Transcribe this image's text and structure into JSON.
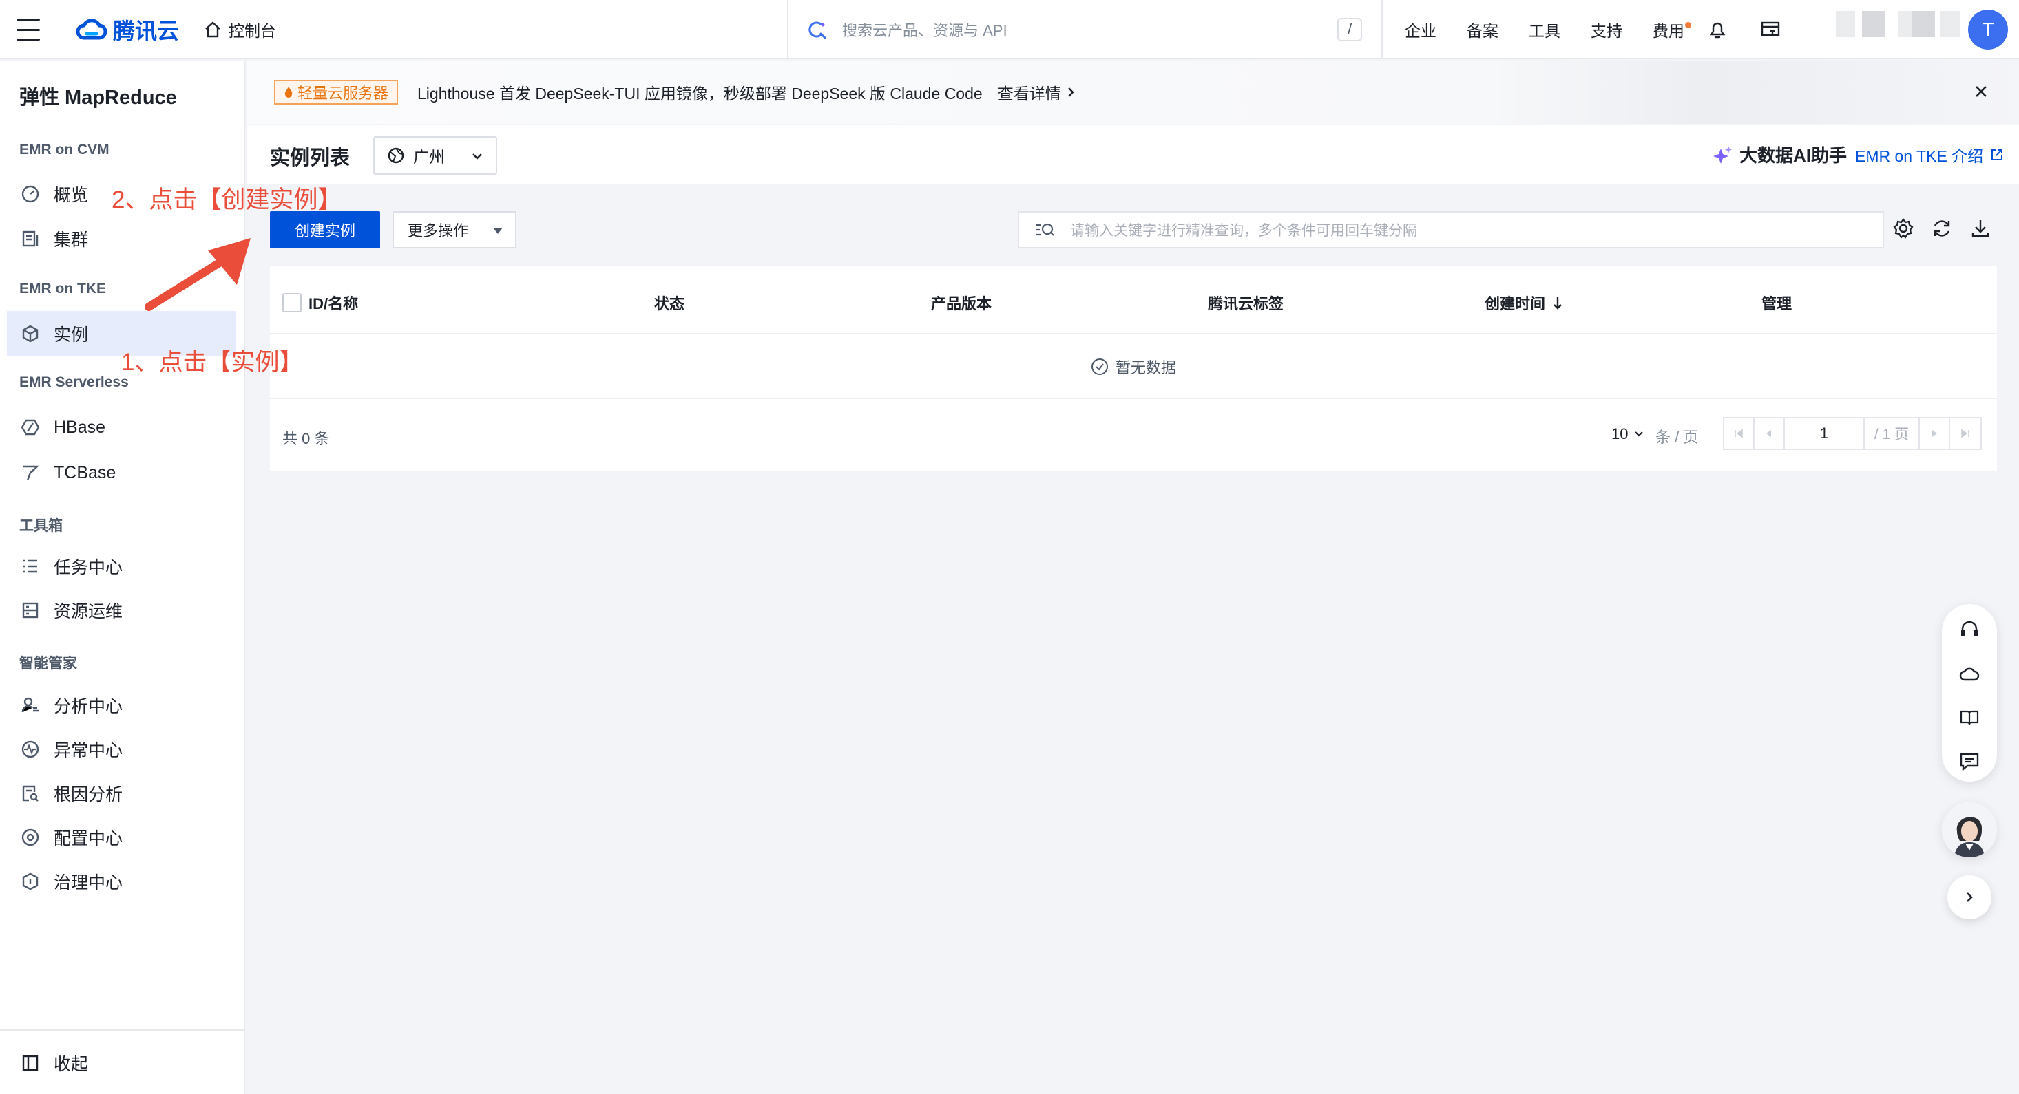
{
  "topbar": {
    "brand": "腾讯云",
    "console": "控制台",
    "search_placeholder": "搜索云产品、资源与 API",
    "search_shortcut": "/",
    "nav": [
      "企业",
      "备案",
      "工具",
      "支持",
      "费用"
    ],
    "avatar_letter": "T",
    "accent": "#0052d9",
    "notice_dot_color": "#f5793a"
  },
  "sidebar": {
    "title": "弹性 MapReduce",
    "groups": {
      "cvm": "EMR on CVM",
      "tke": "EMR on TKE",
      "serverless": "EMR Serverless",
      "toolbox": "工具箱",
      "butler": "智能管家"
    },
    "items": {
      "overview": "概览",
      "cluster": "集群",
      "instance": "实例",
      "hbase": "HBase",
      "tcbase": "TCBase",
      "task_center": "任务中心",
      "resource_ops": "资源运维",
      "analysis": "分析中心",
      "anomaly": "异常中心",
      "root_cause": "根因分析",
      "config": "配置中心",
      "governance": "治理中心"
    },
    "collapse": "收起",
    "active_item": "实例"
  },
  "banner": {
    "badge": "轻量云服务器",
    "text": "Lighthouse 首发 DeepSeek-TUI 应用镜像，秒级部署 DeepSeek 版 Claude Code",
    "link": "查看详情"
  },
  "page": {
    "title": "实例列表",
    "region": "广州",
    "ai_helper": "大数据AI助手",
    "tke_intro": "EMR on TKE 介绍"
  },
  "toolbar": {
    "create": "创建实例",
    "more": "更多操作",
    "filter_placeholder": "请输入关键字进行精准查询，多个条件可用回车键分隔"
  },
  "table": {
    "columns": [
      "ID/名称",
      "状态",
      "产品版本",
      "腾讯云标签",
      "创建时间",
      "管理"
    ],
    "empty": "暂无数据",
    "total": "共 0 条",
    "page_size": "10",
    "per_page": "条 / 页",
    "current_page": "1",
    "total_pages": "/ 1 页"
  },
  "annotations": {
    "step1": "1、点击【实例】",
    "step2": "2、点击【创建实例】",
    "color": "#ea4d39"
  }
}
